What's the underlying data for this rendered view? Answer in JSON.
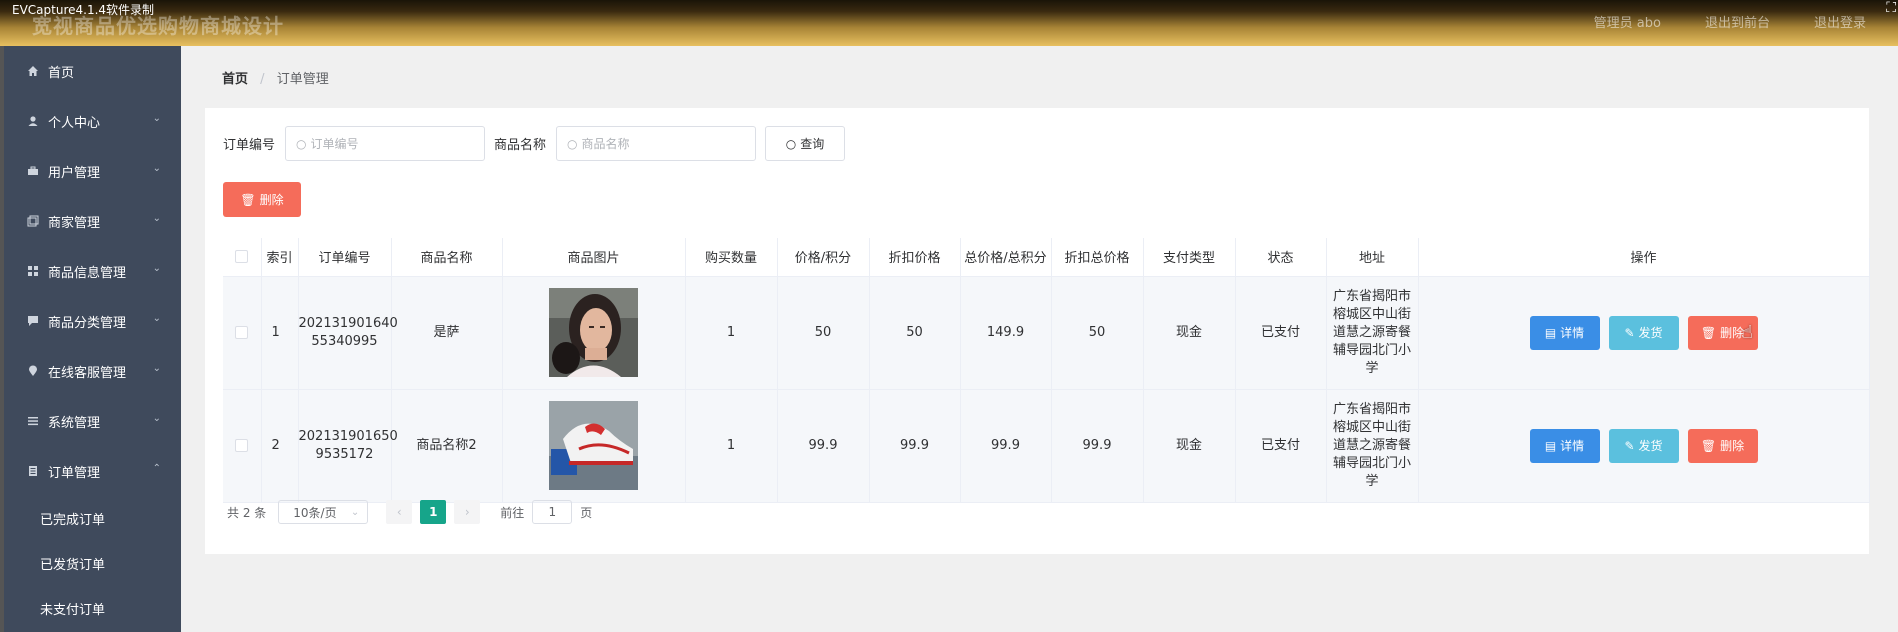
{
  "capture_label": "EVCapture4.1.4软件录制",
  "header": {
    "title": "宽视商品优选购物商城设计",
    "user": "管理员 abo",
    "back_front": "退出到前台",
    "logout": "退出登录"
  },
  "sidebar": {
    "items": [
      {
        "label": "首页",
        "icon": "home-icon"
      },
      {
        "label": "个人中心",
        "icon": "user-icon"
      },
      {
        "label": "用户管理",
        "icon": "briefcase-icon"
      },
      {
        "label": "商家管理",
        "icon": "copy-icon"
      },
      {
        "label": "商品信息管理",
        "icon": "grid-icon"
      },
      {
        "label": "商品分类管理",
        "icon": "chat-icon"
      },
      {
        "label": "在线客服管理",
        "icon": "location-icon"
      },
      {
        "label": "系统管理",
        "icon": "menu-icon"
      },
      {
        "label": "订单管理",
        "icon": "document-icon"
      }
    ],
    "sub_items": [
      "已完成订单",
      "已发货订单",
      "未支付订单"
    ]
  },
  "breadcrumb": {
    "home": "首页",
    "sep": "/",
    "current": "订单管理"
  },
  "search": {
    "order_label": "订单编号",
    "order_placeholder": "订单编号",
    "product_label": "商品名称",
    "product_placeholder": "商品名称",
    "query_button": "查询"
  },
  "delete_button": "删除",
  "table": {
    "headers": [
      "",
      "索引",
      "订单编号",
      "商品名称",
      "商品图片",
      "购买数量",
      "价格/积分",
      "折扣价格",
      "总价格/总积分",
      "折扣总价格",
      "支付类型",
      "状态",
      "地址",
      "操作"
    ],
    "rows": [
      {
        "index": "1",
        "order_no": "20213190164055340995",
        "order_no_l1": "202131901640",
        "order_no_l2": "55340995",
        "product": "是萨",
        "image": "portrait-photo",
        "qty": "1",
        "price": "50",
        "discount_price": "50",
        "total": "149.9",
        "discount_total": "50",
        "pay_type": "现金",
        "status": "已支付",
        "address": "广东省揭阳市榕城区中山街道慧之源寄餐辅导园北门小学"
      },
      {
        "index": "2",
        "order_no": "2021319016509535172",
        "order_no_l1": "202131901650",
        "order_no_l2": "9535172",
        "product": "商品名称2",
        "image": "sneaker-photo",
        "qty": "1",
        "price": "99.9",
        "discount_price": "99.9",
        "total": "99.9",
        "discount_total": "99.9",
        "pay_type": "现金",
        "status": "已支付",
        "address": "广东省揭阳市榕城区中山街道慧之源寄餐辅导园北门小学"
      }
    ],
    "actions": {
      "detail": "详情",
      "ship": "发货",
      "delete": "删除"
    }
  },
  "pagination": {
    "total": "共 2 条",
    "page_size": "10条/页",
    "current_page": "1",
    "goto_prefix": "前往",
    "goto_value": "1",
    "goto_suffix": "页"
  }
}
